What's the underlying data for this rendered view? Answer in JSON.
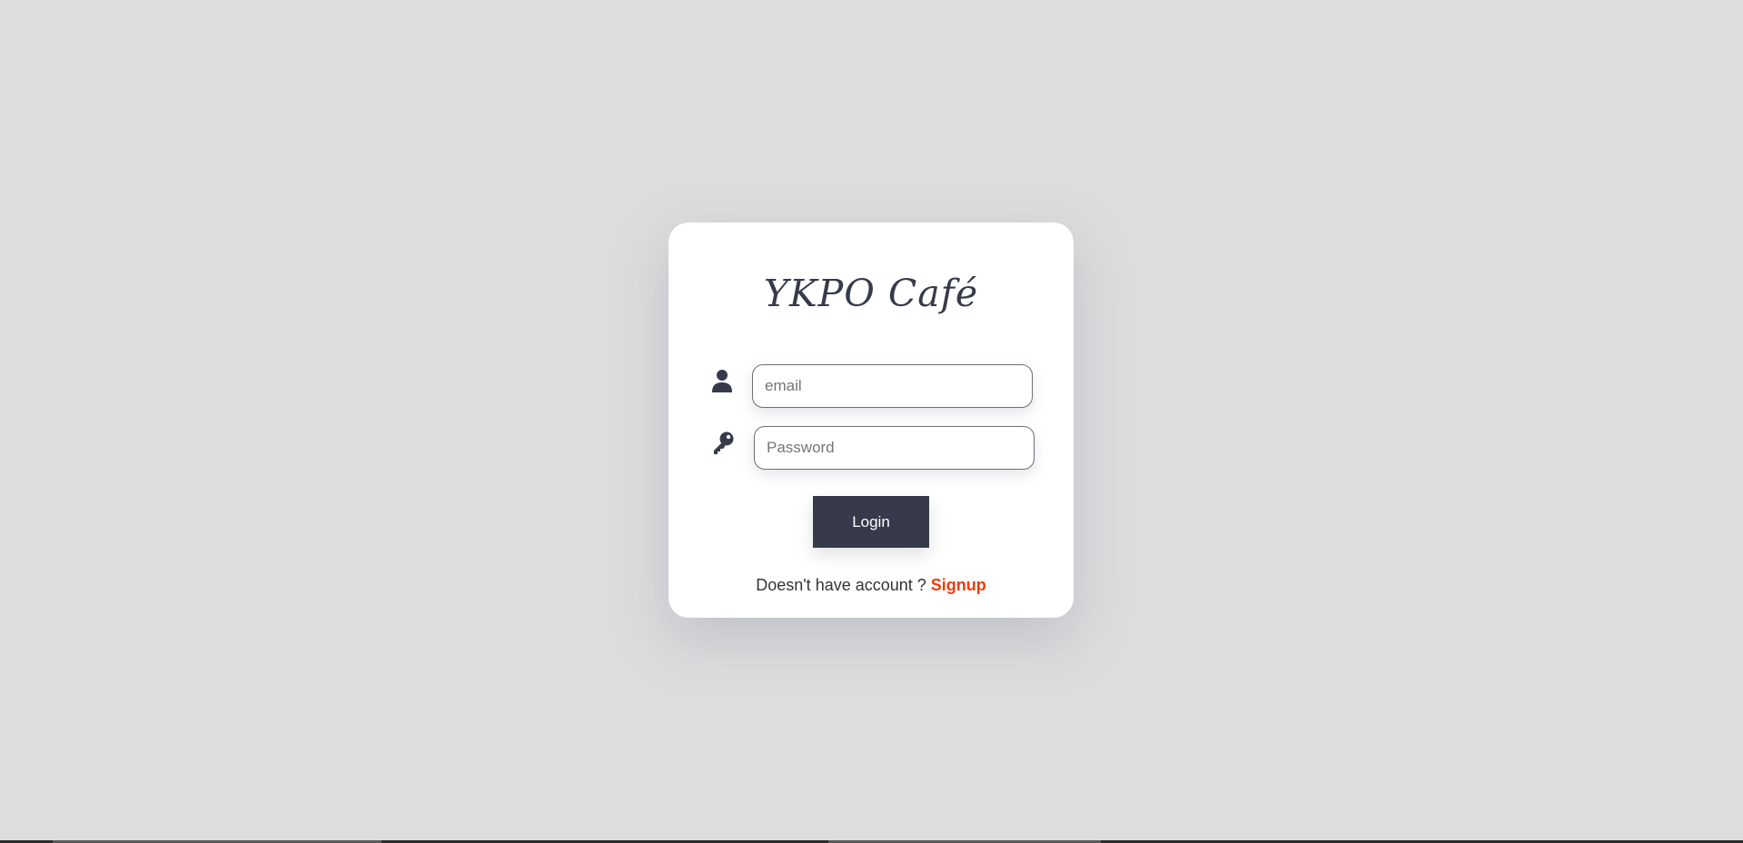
{
  "brand": {
    "title": "YKPO Café"
  },
  "login_form": {
    "email": {
      "placeholder": "email",
      "value": "",
      "icon": "user-icon"
    },
    "password": {
      "placeholder": "Password",
      "value": "",
      "icon": "key-icon"
    },
    "login_label": "Login",
    "signup_prompt": "Doesn't have account ? ",
    "signup_link": "Signup"
  },
  "colors": {
    "background": "#dddddd",
    "card": "#ffffff",
    "primary": "#363a4b",
    "accent": "#f03c0a"
  }
}
